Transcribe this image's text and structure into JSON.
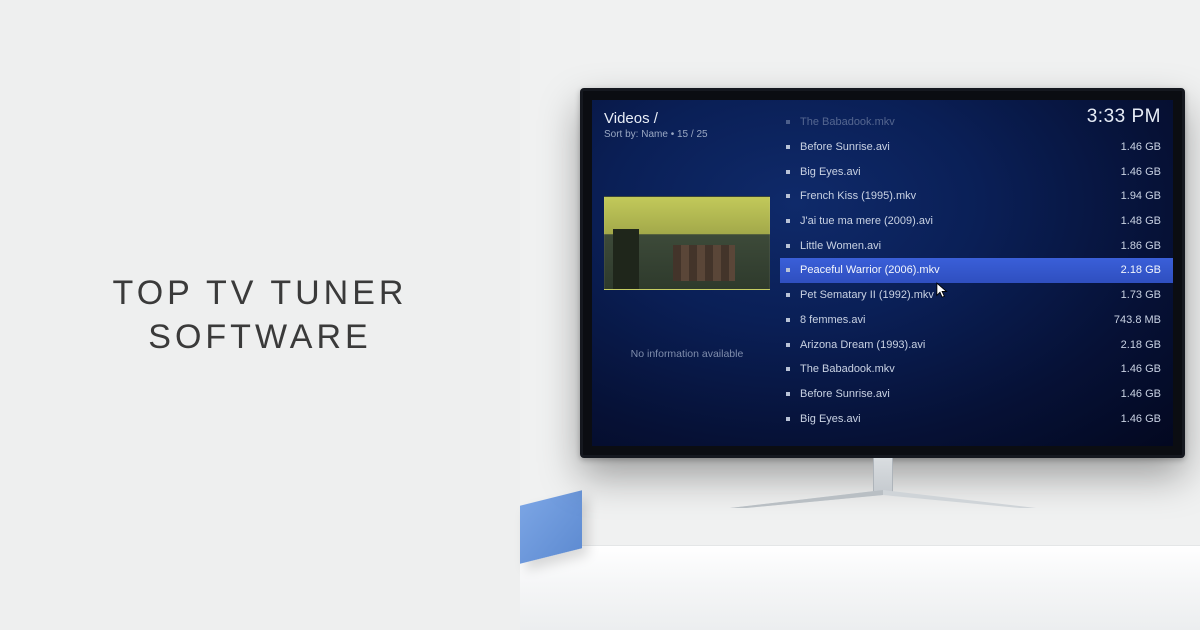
{
  "promo": {
    "title_line1": "TOP  TV  TUNER",
    "title_line2": "SOFTWARE"
  },
  "screen": {
    "breadcrumb": "Videos /",
    "sort_label": "Sort by: Name",
    "counter": "15 / 25",
    "clock": "3:33 PM",
    "no_info": "No information available",
    "files": [
      {
        "name": "The Babadook.mkv",
        "size": "",
        "dim": true,
        "selected": false
      },
      {
        "name": "Before Sunrise.avi",
        "size": "1.46 GB",
        "dim": false,
        "selected": false
      },
      {
        "name": "Big Eyes.avi",
        "size": "1.46 GB",
        "dim": false,
        "selected": false
      },
      {
        "name": "French Kiss (1995).mkv",
        "size": "1.94 GB",
        "dim": false,
        "selected": false
      },
      {
        "name": "J'ai tue ma mere (2009).avi",
        "size": "1.48 GB",
        "dim": false,
        "selected": false
      },
      {
        "name": "Little Women.avi",
        "size": "1.86 GB",
        "dim": false,
        "selected": false
      },
      {
        "name": "Peaceful Warrior (2006).mkv",
        "size": "2.18 GB",
        "dim": false,
        "selected": true
      },
      {
        "name": "Pet Sematary II (1992).mkv",
        "size": "1.73 GB",
        "dim": false,
        "selected": false
      },
      {
        "name": "8 femmes.avi",
        "size": "743.8 MB",
        "dim": false,
        "selected": false
      },
      {
        "name": "Arizona Dream (1993).avi",
        "size": "2.18 GB",
        "dim": false,
        "selected": false
      },
      {
        "name": "The Babadook.mkv",
        "size": "1.46 GB",
        "dim": false,
        "selected": false
      },
      {
        "name": "Before Sunrise.avi",
        "size": "1.46 GB",
        "dim": false,
        "selected": false
      },
      {
        "name": "Big Eyes.avi",
        "size": "1.46 GB",
        "dim": false,
        "selected": false
      }
    ]
  }
}
